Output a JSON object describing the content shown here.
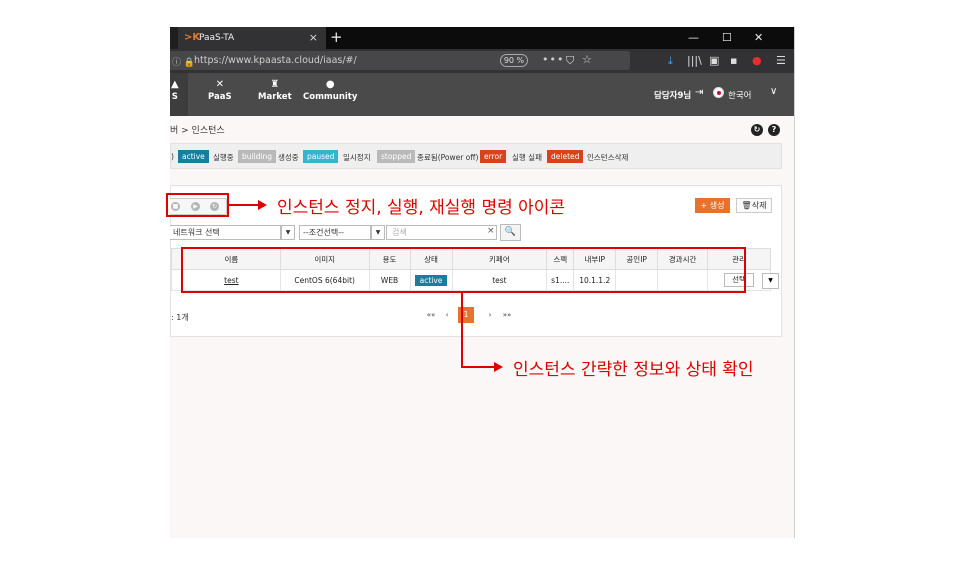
{
  "browser": {
    "tab_title": "PaaS-TA",
    "tab_close": "×",
    "new_tab": "+",
    "url": "https://www.kpaasta.cloud/iaas/#/",
    "zoom": "90 %",
    "more": "•••",
    "minimize": "—",
    "maximize": "☐",
    "close": "✕",
    "menu": "☰"
  },
  "header": {
    "nav_partial": "S",
    "nav": [
      {
        "label": "PaaS",
        "icon": "✕"
      },
      {
        "label": "Market",
        "icon": "♜"
      },
      {
        "label": "Community",
        "icon": "●"
      }
    ],
    "user": "담당자9님",
    "language": "한국어",
    "lang_chevron": "∨"
  },
  "breadcrumb": "버 > 인스턴스",
  "legend": {
    "prefix": ")",
    "items": [
      {
        "badge": "active",
        "text": "실행중",
        "color": "#177ea0"
      },
      {
        "badge": "building",
        "text": "생성중",
        "color": "#b9b9b9"
      },
      {
        "badge": "paused",
        "text": "일시정지",
        "color": "#36b3cf"
      },
      {
        "badge": "stopped",
        "text": "종료됨(Power off)",
        "color": "#b9b9b9"
      },
      {
        "badge": "error",
        "text": "실행 실패",
        "color": "#d9431c"
      },
      {
        "badge": "deleted",
        "text": "인스턴스삭제",
        "color": "#d9431c"
      }
    ]
  },
  "toolbar": {
    "create": "+ 생성",
    "delete": "🗑삭제"
  },
  "filters": {
    "network": "네트워크 선택",
    "condition": "--조건선택--",
    "search_placeholder": "검색",
    "clear": "×",
    "search_icon": "🔍"
  },
  "table": {
    "headers": [
      "이름",
      "이미지",
      "용도",
      "상태",
      "키페어",
      "스펙",
      "내부IP",
      "공인IP",
      "경과시간",
      "관리"
    ],
    "rows": [
      {
        "name": "test",
        "image": "CentOS 6(64bit)",
        "usage": "WEB",
        "status": "active",
        "keypair": "test",
        "spec": "s1....",
        "internal_ip": "10.1.1.2",
        "public_ip": "",
        "elapsed": "",
        "action": "선택"
      }
    ]
  },
  "footer": {
    "total": ": 1개",
    "pager": {
      "first": "««",
      "prev": "‹",
      "current": "1",
      "next": "›",
      "last": "»»"
    }
  },
  "annotations": {
    "controls": "인스턴스 정지, 실행, 재실행 명령 아이콘",
    "summary": "인스턴스 간략한 정보와 상태 확인"
  }
}
